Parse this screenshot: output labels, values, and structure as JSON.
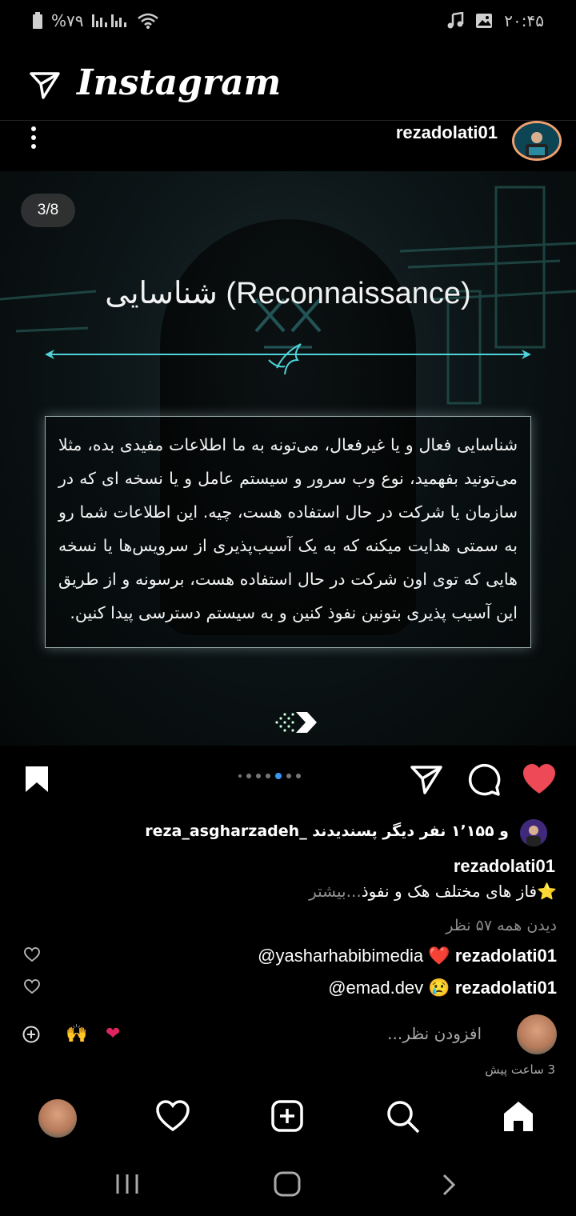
{
  "status_bar": {
    "battery": "%۷۹",
    "time": "۲۰:۴۵"
  },
  "header": {
    "app_title": "Instagram"
  },
  "post": {
    "username": "rezadolati01",
    "slide_counter": "3/8",
    "slide_title": "شناسایی (Reconnaissance)",
    "slide_body": "شناسایی فعال و یا غیرفعال، می‌تونه به ما اطلاعات مفیدی بده، مثلا می‌تونید بفهمید، نوع وب سرور و سیستم عامل و یا نسخه ای که در سازمان یا شرکت در حال استفاده هست، چیه. این اطلاعات شما رو به سمتی هدایت میکنه که به یک آسیب‌پذیری از سرویس‌ها یا نسخه هایی که توی اون شرکت در حال استفاده هست، برسونه و از طریق این آسیب پذیری بتونین نفوذ کنین و به سیستم دسترسی پیدا کنین.",
    "carousel_dots": 6,
    "active_dot": 4,
    "liked": true
  },
  "likes": {
    "text": "و ۱٬۱۵۵ نفر دیگر پسندیدند _reza_asgharzadeh"
  },
  "caption": {
    "username": "rezadolati01",
    "text": "⭐فاز های مختلف هک و نفوذ",
    "more": "...بیشتر"
  },
  "view_all_comments": "دیدن همه ۵۷ نظر",
  "comments": [
    {
      "user": "rezadolati01",
      "emoji": "❤️",
      "text": "@yasharhabibimedia"
    },
    {
      "user": "rezadolati01",
      "emoji": "😢",
      "text": "@emad.dev"
    }
  ],
  "add_comment": {
    "placeholder": "افزودن نظر...",
    "quick_emojis": [
      "🙌",
      "❤"
    ]
  },
  "time_ago": "3 ساعت پیش",
  "colors": {
    "like_red": "#ed4956",
    "dot_blue": "#3897f0",
    "accent_teal": "#4fd3d9"
  }
}
